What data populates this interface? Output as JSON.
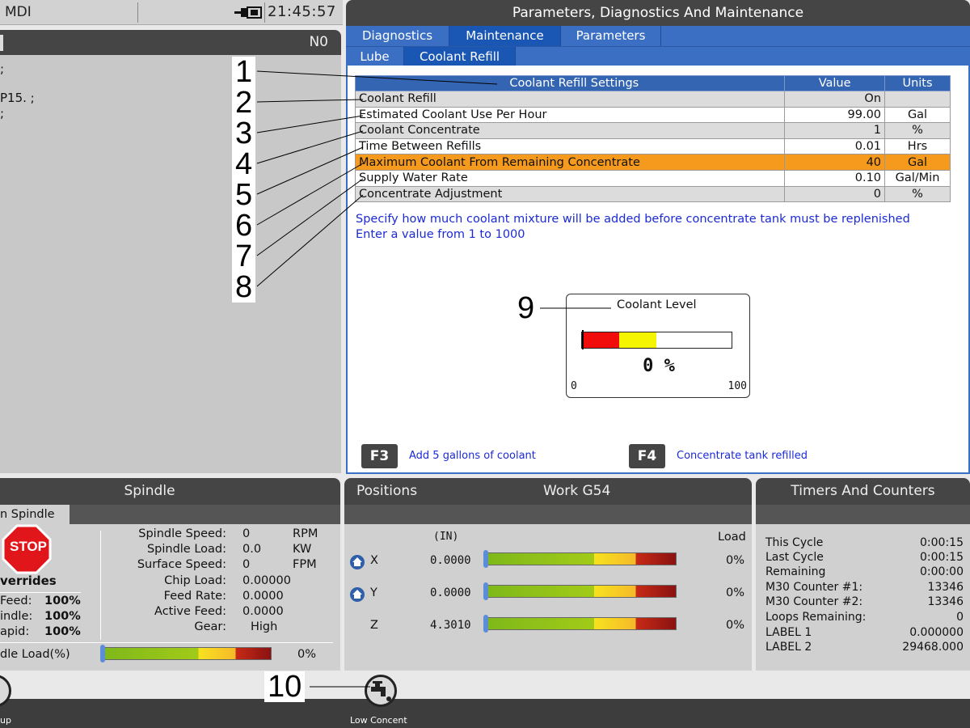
{
  "status_bar": {
    "mode": "MDI",
    "clock": "21:45:57"
  },
  "program": {
    "line_number": "N0",
    "code_lines": [
      ";",
      "P15. ;",
      ";"
    ]
  },
  "pdm": {
    "title": "Parameters, Diagnostics And Maintenance",
    "tabs": [
      "Diagnostics",
      "Maintenance",
      "Parameters"
    ],
    "subtabs": [
      "Lube",
      "Coolant Refill"
    ],
    "table": {
      "headers": [
        "Coolant Refill Settings",
        "Value",
        "Units"
      ],
      "rows": [
        {
          "name": "Coolant Refill",
          "value": "On",
          "unit": ""
        },
        {
          "name": "Estimated Coolant Use Per Hour",
          "value": "99.00",
          "unit": "Gal"
        },
        {
          "name": "Coolant Concentrate",
          "value": "1",
          "unit": "%"
        },
        {
          "name": "Time Between Refills",
          "value": "0.01",
          "unit": "Hrs"
        },
        {
          "name": "Maximum Coolant From Remaining Concentrate",
          "value": "40",
          "unit": "Gal"
        },
        {
          "name": "Supply Water Rate",
          "value": "0.10",
          "unit": "Gal/Min"
        },
        {
          "name": "Concentrate Adjustment",
          "value": "0",
          "unit": "%"
        }
      ]
    },
    "help_lines": [
      "Specify how much coolant mixture will be added before concentrate tank must be replenished",
      "Enter a value from 1 to 1000"
    ],
    "gauge": {
      "title": "Coolant Level",
      "percent_label": "0 %",
      "min": "0",
      "max": "100"
    },
    "fkeys": [
      {
        "key": "F3",
        "label": "Add 5 gallons of coolant"
      },
      {
        "key": "F4",
        "label": "Concentrate tank refilled"
      }
    ]
  },
  "spindle": {
    "title": "Spindle",
    "subtab": "n Spindle",
    "stop_label": "STOP",
    "overrides_title": "verrides",
    "overrides": [
      {
        "label": "Feed:",
        "value": "100%"
      },
      {
        "label": "indle:",
        "value": "100%"
      },
      {
        "label": "apid:",
        "value": "100%"
      }
    ],
    "stats": [
      {
        "label": "Spindle Speed:",
        "value": "0",
        "unit": "RPM"
      },
      {
        "label": "Spindle Load:",
        "value": "0.0",
        "unit": "KW"
      },
      {
        "label": "Surface Speed:",
        "value": "0",
        "unit": "FPM"
      },
      {
        "label": "Chip Load:",
        "value": "0.00000",
        "unit": ""
      },
      {
        "label": "Feed Rate:",
        "value": "0.0000",
        "unit": ""
      },
      {
        "label": "Active Feed:",
        "value": "0.0000",
        "unit": ""
      },
      {
        "label": "Gear:",
        "value": "High",
        "unit": ""
      }
    ],
    "load_label": "dle Load(%)",
    "load_value": "0%"
  },
  "positions": {
    "title_left": "Positions",
    "title_right": "Work G54",
    "unit_label": "(IN)",
    "load_label": "Load",
    "axes": [
      {
        "axis": "X",
        "value": "0.0000",
        "load": "0%"
      },
      {
        "axis": "Y",
        "value": "0.0000",
        "load": "0%"
      },
      {
        "axis": "Z",
        "value": "4.3010",
        "load": "0%"
      }
    ]
  },
  "timers": {
    "title": "Timers And Counters",
    "rows": [
      {
        "label": "This Cycle",
        "value": "0:00:15"
      },
      {
        "label": "Last Cycle",
        "value": "0:00:15"
      },
      {
        "label": "Remaining",
        "value": "0:00:00"
      },
      {
        "label": "M30 Counter #1:",
        "value": "13346"
      },
      {
        "label": "M30 Counter #2:",
        "value": "13346"
      },
      {
        "label": "Loops Remaining:",
        "value": "0"
      },
      {
        "label": "LABEL 1",
        "value": "0.000000"
      },
      {
        "label": "LABEL 2",
        "value": "29468.000"
      }
    ]
  },
  "bottom_bar": {
    "left_label": "up",
    "center_label": "Low Concent"
  },
  "callouts": [
    "1",
    "2",
    "3",
    "4",
    "5",
    "6",
    "7",
    "8",
    "9",
    "10"
  ]
}
